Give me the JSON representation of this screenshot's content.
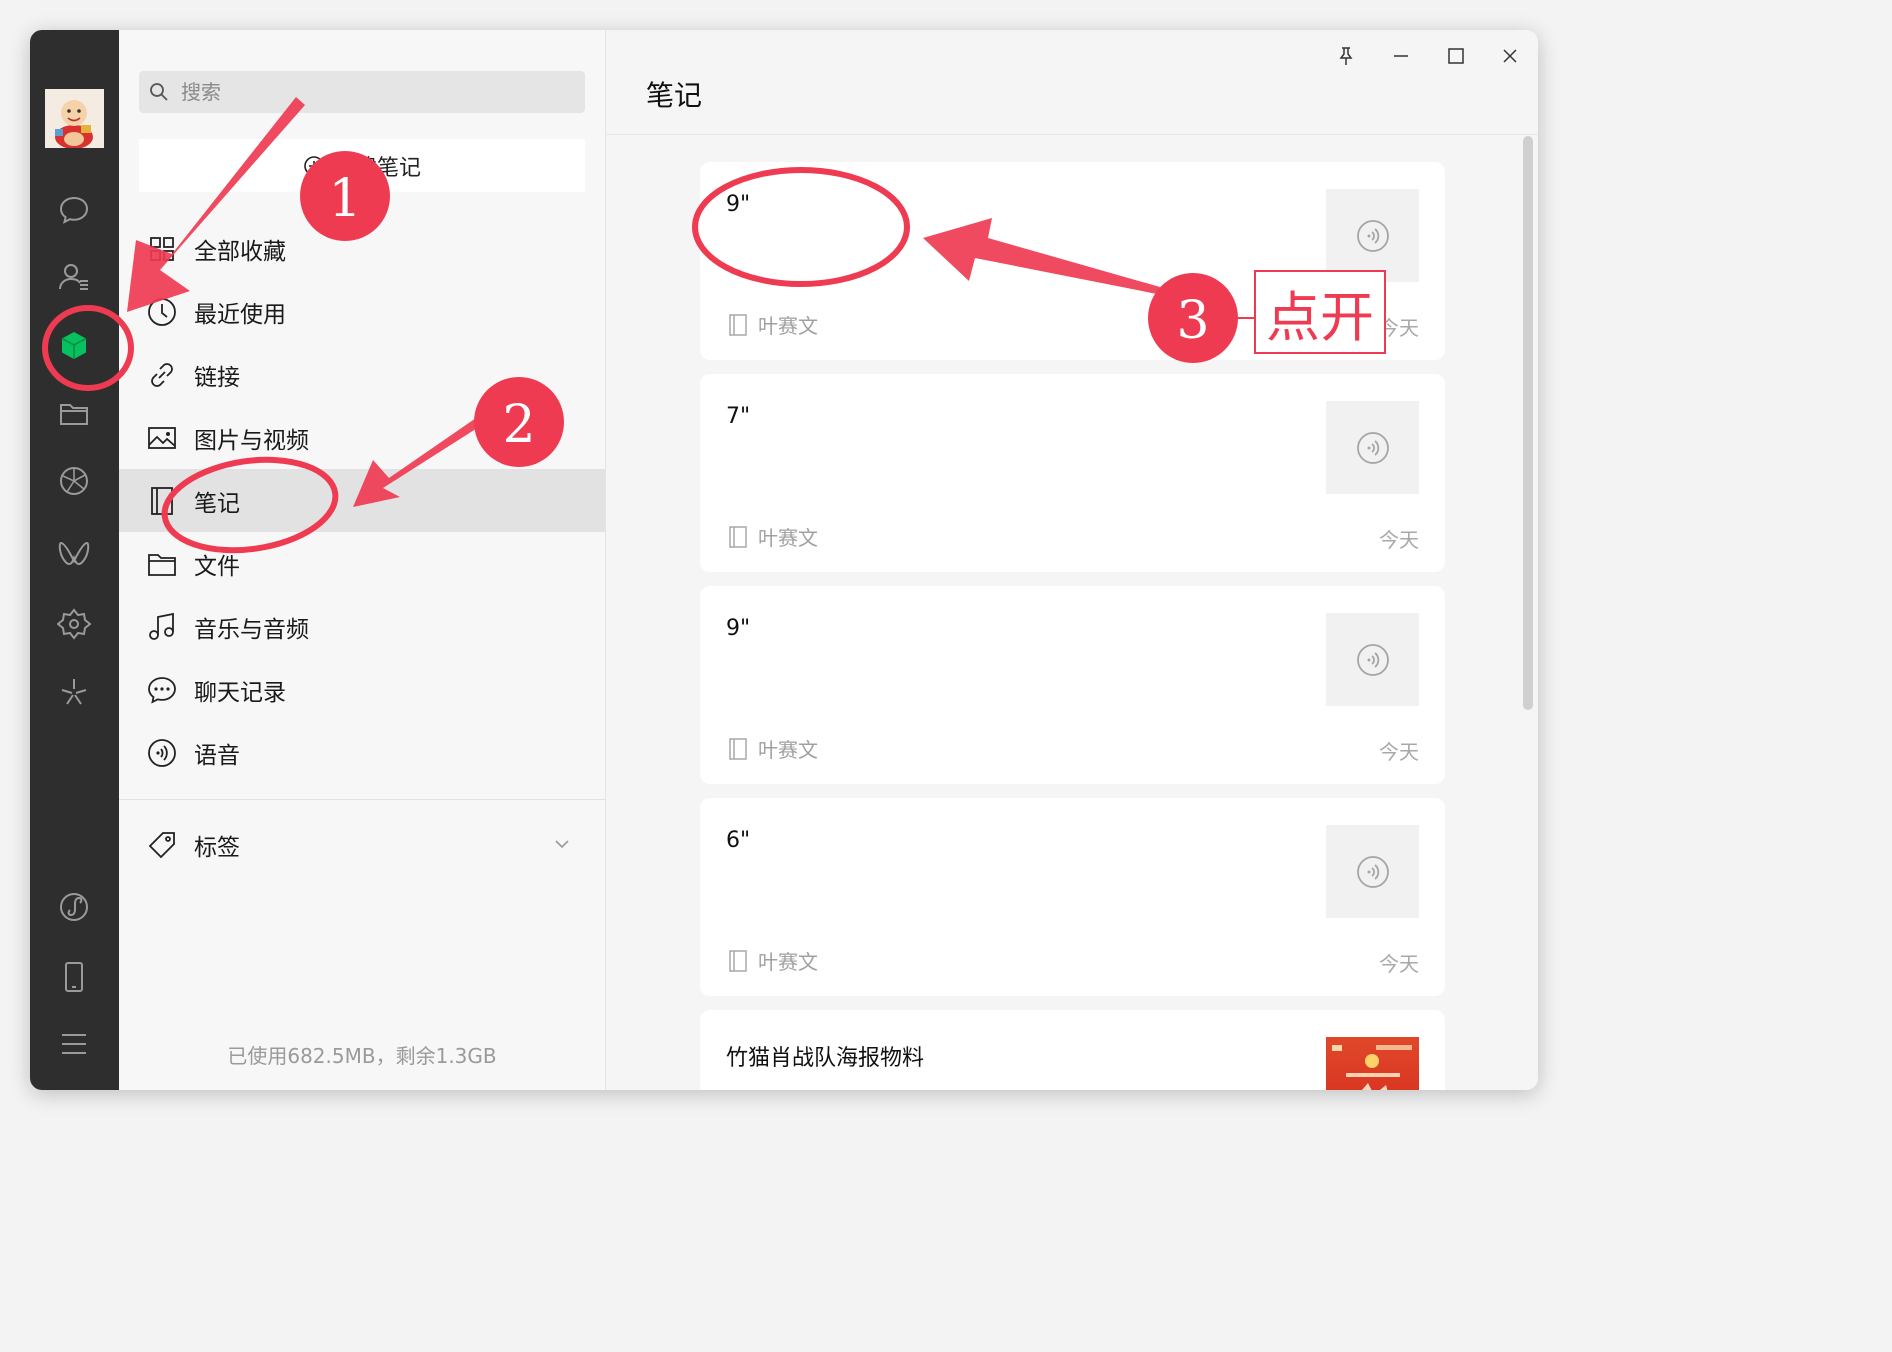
{
  "sidebar": {
    "avatar_label": "avatar",
    "icons": [
      "chat-icon",
      "contacts-icon",
      "favorites-cube-icon",
      "folder-icon",
      "moments-icon",
      "channels-icon",
      "miniprogram-icon",
      "search-discover-icon",
      "miniprogram-link-icon",
      "phone-icon",
      "menu-icon"
    ],
    "active_icon": "favorites-cube-icon",
    "active_color": "#07c160"
  },
  "middle": {
    "search_placeholder": "搜索",
    "new_note_label": "新建笔记",
    "categories": [
      {
        "label": "全部收藏",
        "icon": "all-favorites-icon"
      },
      {
        "label": "最近使用",
        "icon": "clock-icon"
      },
      {
        "label": "链接",
        "icon": "link-icon"
      },
      {
        "label": "图片与视频",
        "icon": "image-icon"
      },
      {
        "label": "笔记",
        "icon": "note-icon",
        "active": true
      },
      {
        "label": "文件",
        "icon": "folder-icon"
      },
      {
        "label": "音乐与音频",
        "icon": "music-icon"
      },
      {
        "label": "聊天记录",
        "icon": "chat-record-icon"
      },
      {
        "label": "语音",
        "icon": "voice-icon"
      }
    ],
    "tags_label": "标签",
    "storage_text": "已使用682.5MB，剩余1.3GB"
  },
  "main": {
    "title": "笔记",
    "notes": [
      {
        "title": "9\"",
        "source": "叶赛文",
        "date": "今天",
        "thumb_icon": "voice-icon"
      },
      {
        "title": "7\"",
        "source": "叶赛文",
        "date": "今天",
        "thumb_icon": "voice-icon"
      },
      {
        "title": "9\"",
        "source": "叶赛文",
        "date": "今天",
        "thumb_icon": "voice-icon"
      },
      {
        "title": "6\"",
        "source": "叶赛文",
        "date": "今天",
        "thumb_icon": "voice-icon"
      },
      {
        "title": "竹猫肖战队海报物料",
        "thumb_icon": "poster-image"
      }
    ]
  },
  "window_controls": [
    "pin-icon",
    "minimize-icon",
    "maximize-icon",
    "close-icon"
  ],
  "annotations": {
    "steps": [
      "1",
      "2",
      "3"
    ],
    "callout_text": "点开",
    "color": "#ef3b52"
  }
}
